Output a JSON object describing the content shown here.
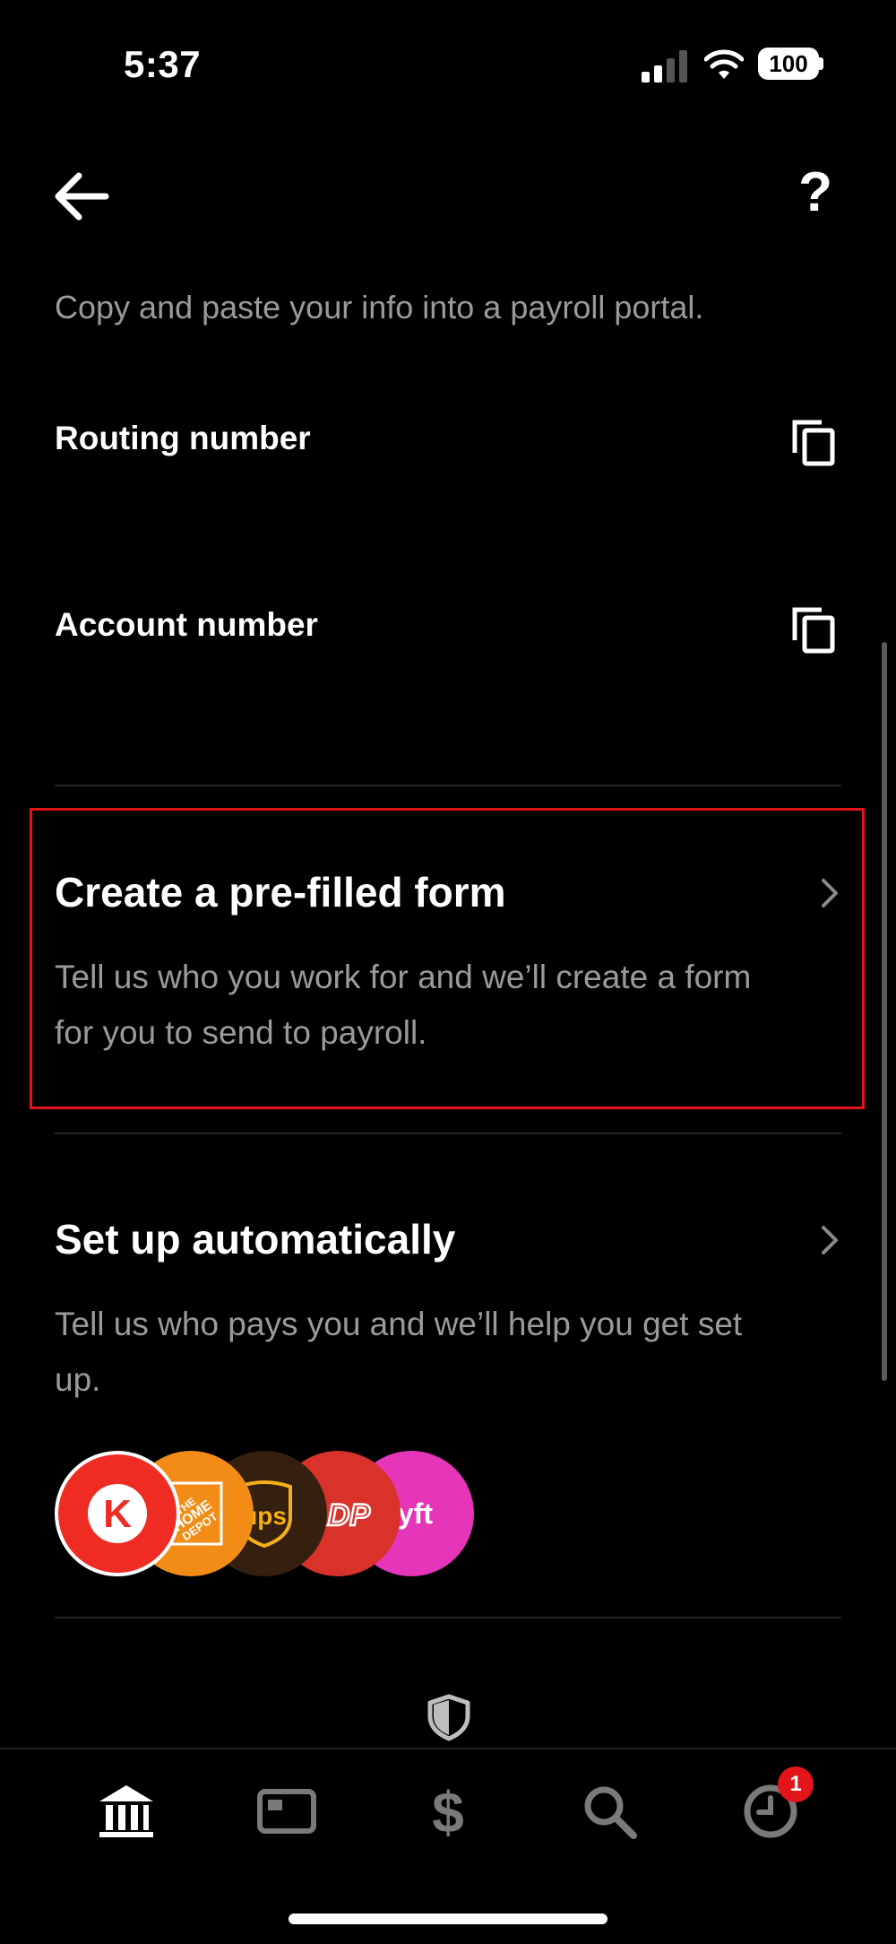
{
  "status_bar": {
    "time": "5:37",
    "battery": "100"
  },
  "header": {
    "help_glyph": "?"
  },
  "intro": "Copy and paste your info into a payroll portal.",
  "fields": [
    {
      "label": "Routing number"
    },
    {
      "label": "Account number"
    }
  ],
  "prefilled": {
    "title": "Create a pre-filled form",
    "description": "Tell us who you work for and we’ll create a form for you to send to payroll."
  },
  "automatic": {
    "title": "Set up automatically",
    "description": "Tell us who pays you and we’ll help you get set up.",
    "logos": [
      {
        "name": "circle-k-logo",
        "text": "K",
        "color": "#ee2c24"
      },
      {
        "name": "home-depot-logo",
        "text": "THE HOME DEPOT",
        "color": "#f28c17"
      },
      {
        "name": "ups-logo",
        "text": "ups",
        "color": "#35200f"
      },
      {
        "name": "adp-logo",
        "text": "ADP",
        "color": "#d8322b"
      },
      {
        "name": "lyft-logo",
        "text": "lyft",
        "color": "#e535b8"
      }
    ]
  },
  "tabs": [
    {
      "name": "tab-banking",
      "icon": "bank-icon"
    },
    {
      "name": "tab-card",
      "icon": "card-icon"
    },
    {
      "name": "tab-money",
      "icon": "dollar-icon"
    },
    {
      "name": "tab-search",
      "icon": "search-icon"
    },
    {
      "name": "tab-activity",
      "icon": "clock-icon"
    }
  ],
  "activity_badge": "1",
  "colors": {
    "accent_red": "#e4141b",
    "muted_text": "#9a9a9a"
  }
}
